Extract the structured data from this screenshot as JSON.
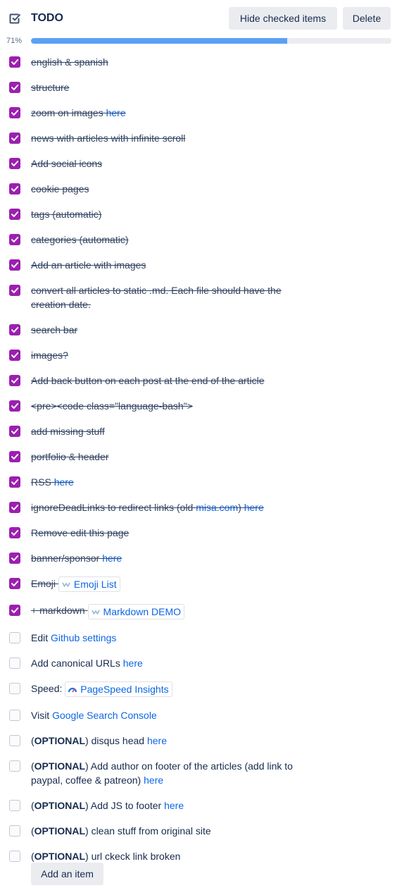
{
  "header": {
    "title": "TODO",
    "hide_checked_label": "Hide checked items",
    "delete_label": "Delete"
  },
  "progress": {
    "label": "71%",
    "value": 0.71
  },
  "items": [
    {
      "checked": true,
      "parts": [
        {
          "t": "english & spanish"
        }
      ]
    },
    {
      "checked": true,
      "parts": [
        {
          "t": "structure"
        }
      ]
    },
    {
      "checked": true,
      "parts": [
        {
          "t": "zoom on images "
        },
        {
          "t": "here",
          "link": true
        }
      ]
    },
    {
      "checked": true,
      "parts": [
        {
          "t": "news with articles with infinite scroll"
        }
      ]
    },
    {
      "checked": true,
      "parts": [
        {
          "t": "Add social icons"
        }
      ]
    },
    {
      "checked": true,
      "parts": [
        {
          "t": "cookie pages"
        }
      ]
    },
    {
      "checked": true,
      "parts": [
        {
          "t": "tags (automatic)"
        }
      ]
    },
    {
      "checked": true,
      "parts": [
        {
          "t": "categories (automatic)"
        }
      ]
    },
    {
      "checked": true,
      "parts": [
        {
          "t": "Add an article with images"
        }
      ]
    },
    {
      "checked": true,
      "parts": [
        {
          "t": "convert all articles to static .md. Each file should have the creation date."
        }
      ]
    },
    {
      "checked": true,
      "parts": [
        {
          "t": "search bar"
        }
      ]
    },
    {
      "checked": true,
      "parts": [
        {
          "t": "images?"
        }
      ]
    },
    {
      "checked": true,
      "parts": [
        {
          "t": "Add back button on each post at the end of the article"
        }
      ]
    },
    {
      "checked": true,
      "parts": [
        {
          "t": "<pre><code class=\"language-bash\">"
        }
      ]
    },
    {
      "checked": true,
      "parts": [
        {
          "t": "add missing stuff"
        }
      ]
    },
    {
      "checked": true,
      "parts": [
        {
          "t": "portfolio & header"
        }
      ]
    },
    {
      "checked": true,
      "parts": [
        {
          "t": "RSS "
        },
        {
          "t": "here",
          "link": true
        }
      ]
    },
    {
      "checked": true,
      "parts": [
        {
          "t": "ignoreDeadLinks to redirect links (old "
        },
        {
          "t": "misa.com",
          "link": true
        },
        {
          "t": ") "
        },
        {
          "t": "here",
          "link": true
        }
      ]
    },
    {
      "checked": true,
      "parts": [
        {
          "t": "Remove edit this page"
        }
      ]
    },
    {
      "checked": true,
      "parts": [
        {
          "t": "banner/sponsor "
        },
        {
          "t": "here",
          "link": true
        }
      ]
    },
    {
      "checked": true,
      "parts": [
        {
          "t": "Emoji "
        },
        {
          "t": "Emoji List",
          "chip": true,
          "icon": "web-favicon-icon"
        }
      ]
    },
    {
      "checked": true,
      "parts": [
        {
          "t": "+ markdown "
        },
        {
          "t": "Markdown DEMO",
          "chip": true,
          "icon": "web-favicon-icon"
        }
      ]
    },
    {
      "checked": false,
      "parts": [
        {
          "t": "Edit "
        },
        {
          "t": "Github settings",
          "link": true
        }
      ]
    },
    {
      "checked": false,
      "parts": [
        {
          "t": "Add canonical URLs "
        },
        {
          "t": "here",
          "link": true
        }
      ]
    },
    {
      "checked": false,
      "parts": [
        {
          "t": "Speed: "
        },
        {
          "t": "PageSpeed Insights",
          "chip": true,
          "icon": "pagespeed-icon"
        }
      ]
    },
    {
      "checked": false,
      "parts": [
        {
          "t": "Visit "
        },
        {
          "t": "Google Search Console",
          "link": true
        }
      ]
    },
    {
      "checked": false,
      "parts": [
        {
          "t": "("
        },
        {
          "t": "OPTIONAL",
          "bold": true
        },
        {
          "t": ") disqus head "
        },
        {
          "t": "here",
          "link": true
        }
      ]
    },
    {
      "checked": false,
      "parts": [
        {
          "t": "("
        },
        {
          "t": "OPTIONAL",
          "bold": true
        },
        {
          "t": ") Add author on footer of the articles (add link to paypal, coffee & patreon) "
        },
        {
          "t": "here",
          "link": true
        }
      ]
    },
    {
      "checked": false,
      "parts": [
        {
          "t": "("
        },
        {
          "t": "OPTIONAL",
          "bold": true
        },
        {
          "t": ") Add JS to footer "
        },
        {
          "t": "here",
          "link": true
        }
      ]
    },
    {
      "checked": false,
      "parts": [
        {
          "t": "("
        },
        {
          "t": "OPTIONAL",
          "bold": true
        },
        {
          "t": ") clean stuff from original site"
        }
      ]
    },
    {
      "checked": false,
      "parts": [
        {
          "t": "("
        },
        {
          "t": "OPTIONAL",
          "bold": true
        },
        {
          "t": ") url ckeck link broken"
        }
      ]
    }
  ],
  "add_item_label": "Add an item",
  "colors": {
    "checked": "#9c1fb0",
    "progress": "#5aa0f5",
    "link": "#0c66e4"
  }
}
